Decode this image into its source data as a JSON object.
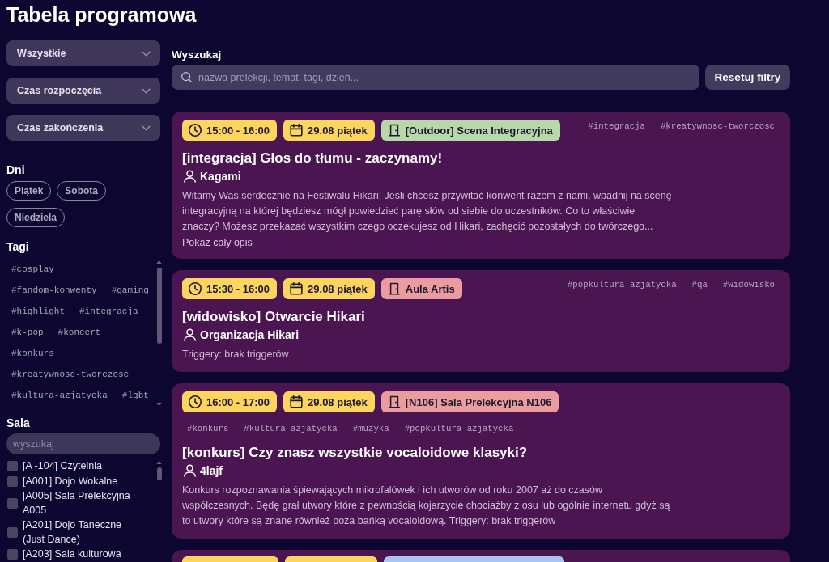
{
  "page_title": "Tabela programowa",
  "sidebar": {
    "selects": [
      {
        "label": "Wszystkie"
      },
      {
        "label": "Czas rozpoczęcia"
      },
      {
        "label": "Czas zakończenia"
      }
    ],
    "days": {
      "title": "Dni",
      "items": [
        {
          "label": "Piątek",
          "selected": false
        },
        {
          "label": "Sobota",
          "selected": false
        },
        {
          "label": "Niedziela",
          "selected": false
        }
      ]
    },
    "tags": {
      "title": "Tagi",
      "items": [
        "#cosplay",
        "#fandom-konwenty",
        "#gaming",
        "#highlight",
        "#integracja",
        "#k-pop",
        "#koncert",
        "#konkurs",
        "#kreatywnosc-tworczosc",
        "#kultura-azjatycka",
        "#lgbt"
      ]
    },
    "rooms": {
      "title": "Sala",
      "search": {
        "placeholder": "wyszukaj"
      },
      "items": [
        {
          "label": "[A -104] Czytelnia",
          "checked": false
        },
        {
          "label": "[A001] Dojo Wokalne",
          "checked": false
        },
        {
          "label": "[A005] Sala Prelekcyjna A005",
          "checked": false
        },
        {
          "label": "[A201] Dojo Taneczne (Just Dance)",
          "checked": false
        },
        {
          "label": "[A203] Sala kulturowa",
          "checked": false
        }
      ]
    }
  },
  "search": {
    "label": "Wyszukaj",
    "placeholder": "nazwa prelekcji, temat, tagi, dzień...",
    "reset_button": "Resetuj filtry"
  },
  "events": [
    {
      "time": "15:00 - 16:00",
      "date": "29.08 piątek",
      "room": {
        "name": "[Outdoor] Scena Integracyjna",
        "color": "#b7d8a8"
      },
      "tags": [
        "#integracja",
        "#kreatywnosc-tworczosc"
      ],
      "title": "[integracja] Głos do tłumu - zaczynamy!",
      "author": "Kagami",
      "description": "Witamy Was serdecznie na Festiwalu Hikari! Jeśli chcesz przywitać konwent razem z nami, wpadnij na scenę integracyjną na której będziesz mógł powiedzieć parę słów od siebie do uczestników. Co to właściwie znaczy? Możesz przekazać wszystkim czego oczekujesz od Hikari, zachęcić pozostałych do twórczego...",
      "more_link": "Pokaż cały opis"
    },
    {
      "time": "15:30 - 16:00",
      "date": "29.08 piątek",
      "room": {
        "name": "Aula Artis",
        "color": "#ea9c9e"
      },
      "tags": [
        "#popkultura-azjatycka",
        "#qa",
        "#widowisko"
      ],
      "title": "[widowisko] Otwarcie Hikari",
      "author": "Organizacja Hikari",
      "description": "Triggery: brak triggerów"
    },
    {
      "time": "16:00 - 17:00",
      "date": "29.08 piątek",
      "room": {
        "name": "[N106] Sala Prelekcyjna N106",
        "color": "#ea9c9e"
      },
      "tags": [
        "#konkurs",
        "#kultura-azjatycka",
        "#muzyka",
        "#popkultura-azjatycka"
      ],
      "title": "[konkurs] Czy znasz wszystkie vocaloidowe klasyki?",
      "author": "4lajf",
      "description": "Konkurs rozpoznawania śpiewających mikrofalówek i ich utworów od roku 2007 aż do czasów współczesnych. Będę grał utwory które z pewnością kojarzycie chociażby z osu lub ogólnie internetu gdyż są to utwory które są znane również poza bańką vocaloidową. Triggery: brak triggerów"
    }
  ],
  "next_event_cut_off": {
    "room": {
      "color": "#a7c4f2"
    }
  }
}
